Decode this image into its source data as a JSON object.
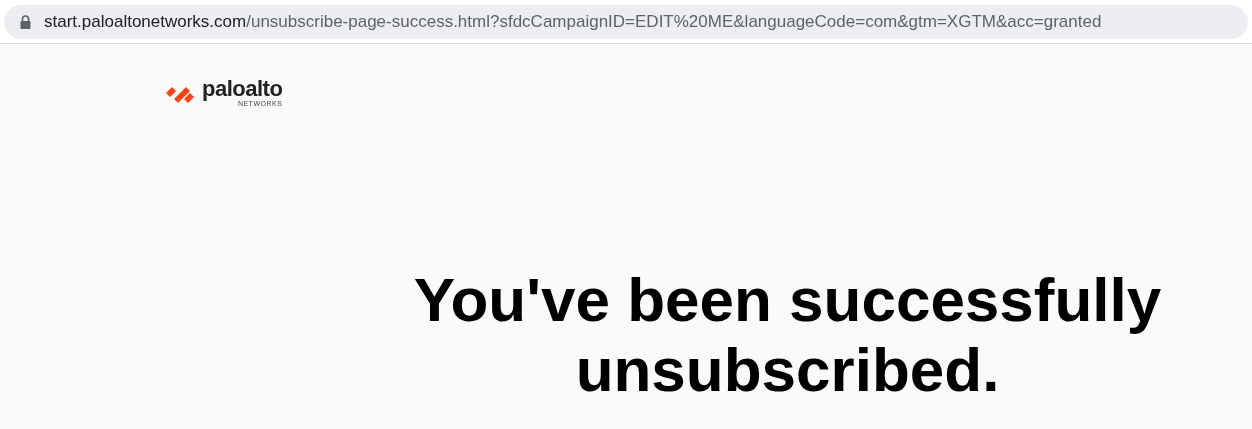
{
  "address_bar": {
    "host": "start.paloaltonetworks.com",
    "path": "/unsubscribe-page-success.html?sfdcCampaignID=EDIT%20ME&languageCode=com&gtm=XGTM&acc=granted",
    "secure": true
  },
  "logo": {
    "wordmark": "paloalto",
    "subtitle": "NETWORKS"
  },
  "heading": "You've been successfully unsubscribed."
}
